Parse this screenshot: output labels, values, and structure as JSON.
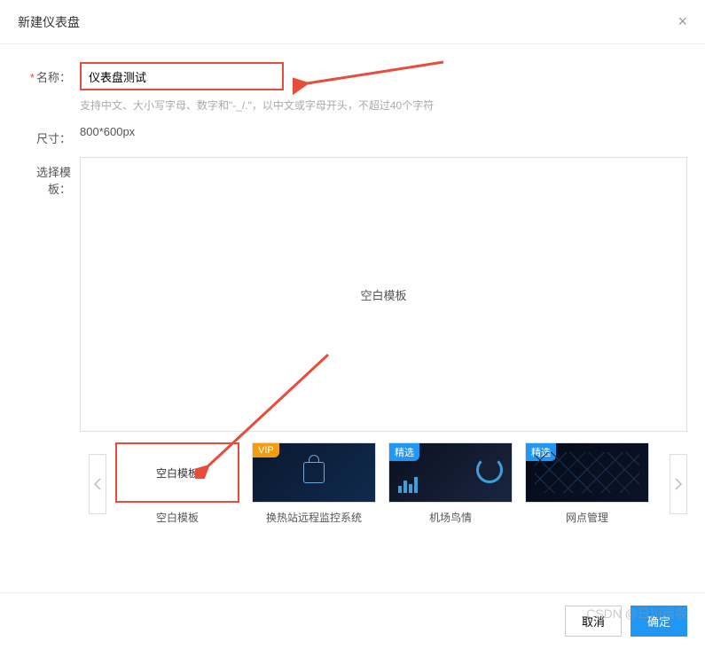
{
  "modal": {
    "title": "新建仪表盘",
    "close": "×"
  },
  "form": {
    "name_label": "名称：",
    "name_value": "仪表盘测试",
    "name_hint": "支持中文、大小写字母、数字和\"-_/.\"，以中文或字母开头，不超过40个字符",
    "size_label": "尺寸：",
    "size_value": "800*600px",
    "template_label": "选择模板："
  },
  "preview": {
    "text": "空白模板"
  },
  "badges": {
    "vip": "VIP",
    "pick": "精选"
  },
  "templates": [
    {
      "label": "空白模板",
      "thumb_text": "空白模板"
    },
    {
      "label": "换热站远程监控系统"
    },
    {
      "label": "机场鸟情"
    },
    {
      "label": "网点管理"
    }
  ],
  "footer": {
    "cancel": "取消",
    "confirm": "确定"
  },
  "watermark": "CSDN @日川岗坂"
}
